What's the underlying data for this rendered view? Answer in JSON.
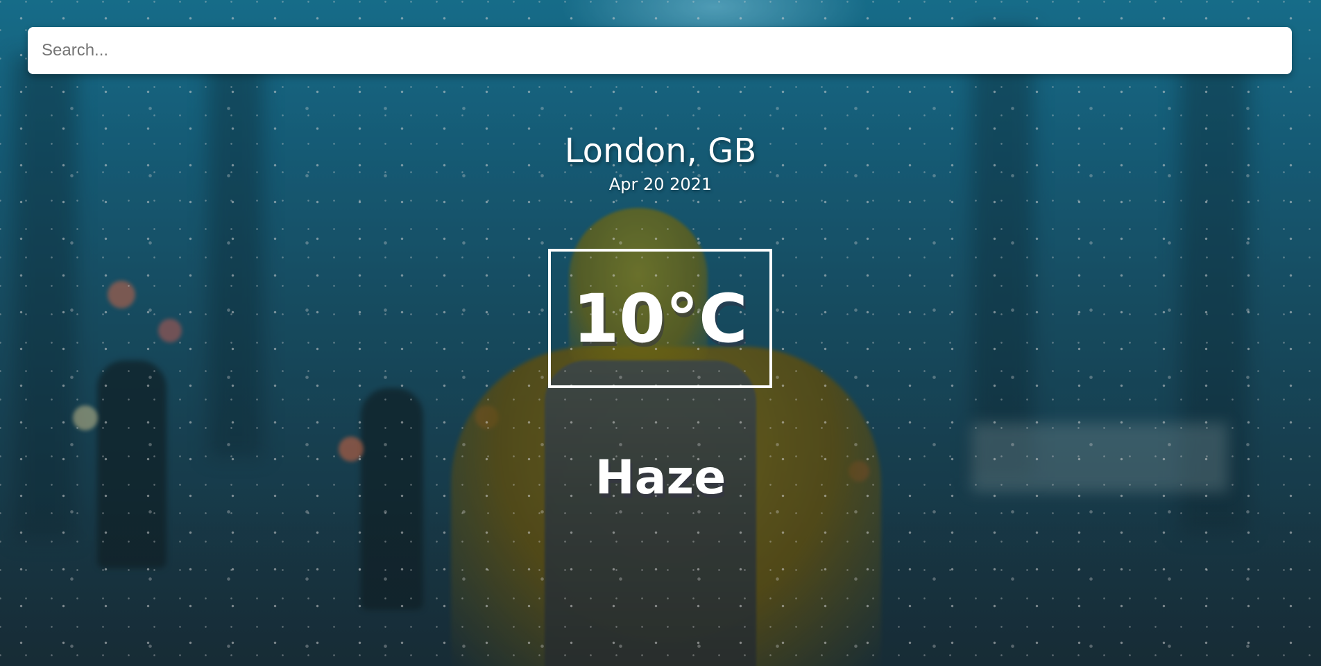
{
  "search": {
    "placeholder": "Search...",
    "value": ""
  },
  "location": {
    "city_country": "London, GB",
    "date": "Apr 20 2021"
  },
  "weather": {
    "temperature": "10°C",
    "condition": "Haze"
  },
  "colors": {
    "text": "#ffffff",
    "search_bg": "#ffffff",
    "background_top": "#1c84a7",
    "background_bottom": "#1e3d4c"
  },
  "background_image": {
    "subject": "winter-snow-person-with-backpack"
  }
}
